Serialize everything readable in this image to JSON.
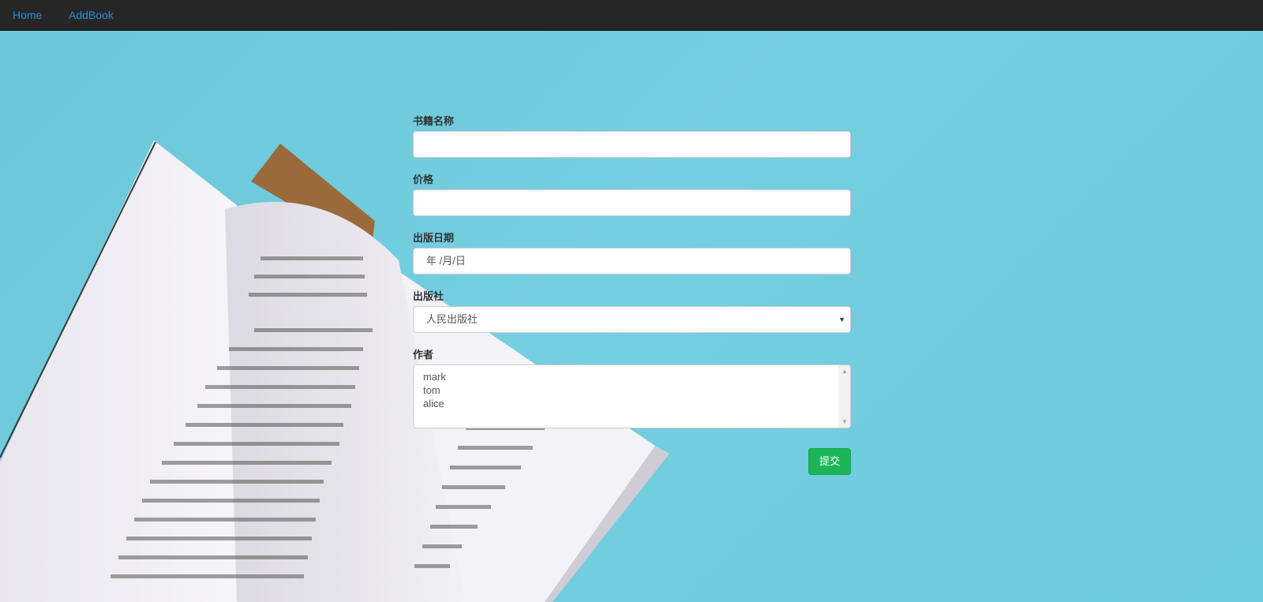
{
  "nav": {
    "home": "Home",
    "addbook": "AddBook"
  },
  "form": {
    "name_label": "书籍名称",
    "name_value": "",
    "price_label": "价格",
    "price_value": "",
    "date_label": "出版日期",
    "date_placeholder": "年 /月/日",
    "publisher_label": "出版社",
    "publisher_selected": "人民出版社",
    "author_label": "作者",
    "authors": [
      "mark",
      "tom",
      "alice"
    ],
    "submit_label": "提交"
  },
  "colors": {
    "navbar": "#262626",
    "link": "#2b8fd6",
    "background": "#6fcbdc",
    "submit": "#1eb55a"
  },
  "icons": {
    "select_arrow": "caret-down-icon",
    "scroll_up": "scroll-up-arrow-icon",
    "scroll_down": "scroll-down-arrow-icon"
  }
}
